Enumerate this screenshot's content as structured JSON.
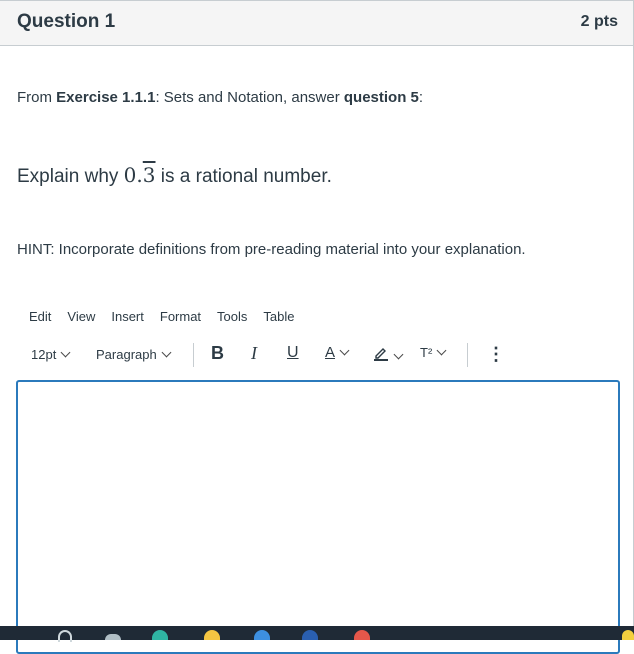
{
  "question": {
    "title": "Question 1",
    "points": "2 pts",
    "intro_prefix": "From ",
    "intro_bold1": "Exercise 1.1.1",
    "intro_mid": ": Sets and Notation, answer ",
    "intro_bold2": "question 5",
    "intro_suffix": ":",
    "prompt_prefix": "Explain why ",
    "prompt_math_whole": "0.",
    "prompt_math_repeat": "3",
    "prompt_suffix": " is a rational number.",
    "hint": "HINT: Incorporate definitions from pre-reading material into your explanation."
  },
  "editor": {
    "menu": [
      "Edit",
      "View",
      "Insert",
      "Format",
      "Tools",
      "Table"
    ],
    "font_size": "12pt",
    "block_format": "Paragraph",
    "bold_label": "B",
    "italic_label": "I",
    "underline_label": "U",
    "text_color_label": "A",
    "superscript_label": "T²",
    "more_label": "⋮",
    "body": ""
  },
  "colors": {
    "text": "#2d3b45",
    "header_bg": "#f5f5f5",
    "border": "#c7cdd1",
    "editor_focus": "#2b7abc",
    "taskbar": "#1f2a36"
  }
}
